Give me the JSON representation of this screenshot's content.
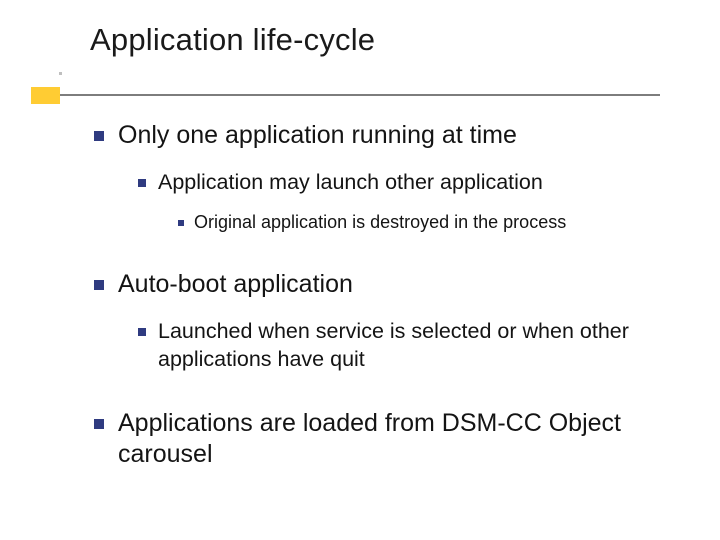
{
  "slide": {
    "title": "Application life-cycle",
    "accent_color": "#ffcc33",
    "bullet_color": "#2f3b80",
    "points": [
      {
        "text": "Only one application running at time",
        "children": [
          {
            "text": "Application may launch other application",
            "children": [
              {
                "text": "Original application is destroyed in the process"
              }
            ]
          }
        ]
      },
      {
        "text": "Auto-boot application",
        "children": [
          {
            "text": "Launched when service is selected or when other applications have quit"
          }
        ]
      },
      {
        "text": "Applications are loaded from DSM-CC Object carousel"
      }
    ]
  }
}
